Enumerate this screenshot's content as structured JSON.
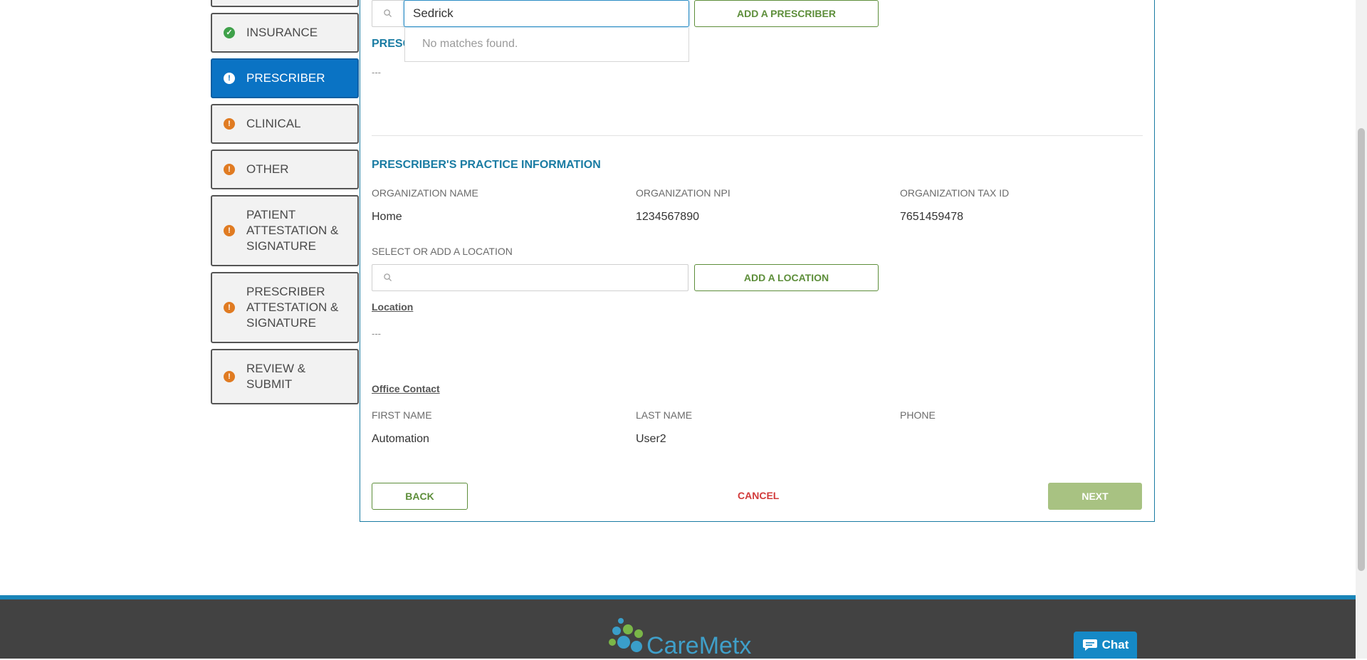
{
  "sidebar": {
    "items": [
      {
        "label": "INSURANCE",
        "status": "complete"
      },
      {
        "label": "PRESCRIBER",
        "status": "active"
      },
      {
        "label": "CLINICAL",
        "status": "incomplete"
      },
      {
        "label": "OTHER",
        "status": "incomplete"
      },
      {
        "label_lines": [
          "PATIENT",
          "ATTESTATION &",
          "SIGNATURE"
        ],
        "status": "incomplete"
      },
      {
        "label_lines": [
          "PRESCRIBER",
          "ATTESTATION &",
          "SIGNATURE"
        ],
        "status": "incomplete"
      },
      {
        "label_lines": [
          "REVIEW &",
          "SUBMIT"
        ],
        "status": "incomplete"
      }
    ],
    "status_icons": {
      "complete": "check-icon",
      "active": "alert-icon",
      "incomplete": "alert-icon"
    }
  },
  "prescriber_search": {
    "value": "Sedrick",
    "dropdown_text": "No matches found.",
    "add_button": "ADD A PRESCRIBER",
    "section_title_partial": "PRESC",
    "empty_value": "---"
  },
  "practice": {
    "title": "PRESCRIBER'S PRACTICE INFORMATION",
    "org_name_label": "ORGANIZATION NAME",
    "org_name_value": "Home",
    "org_npi_label": "ORGANIZATION NPI",
    "org_npi_value": "1234567890",
    "org_tax_label": "ORGANIZATION TAX ID",
    "org_tax_value": "7651459478",
    "location_label": "SELECT OR ADD A LOCATION",
    "add_location_button": "ADD A LOCATION",
    "location_heading": "Location",
    "location_value": "---",
    "office_contact_heading": "Office Contact",
    "first_name_label": "FIRST NAME",
    "first_name_value": "Automation",
    "last_name_label": "LAST NAME",
    "last_name_value": "User2",
    "phone_label": "PHONE"
  },
  "actions": {
    "back": "BACK",
    "cancel": "CANCEL",
    "next": "NEXT"
  },
  "footer": {
    "logo_text": "CareMetx",
    "chat_label": "Chat"
  },
  "colors": {
    "accent_blue": "#1a7ca3",
    "active_blue": "#0a73c4",
    "green": "#5d8e3a",
    "next_green": "#a8c282",
    "cancel_red": "#d23b3b",
    "warn_orange": "#e07b22",
    "ok_green": "#3fa14a",
    "footer_gray": "#424242"
  }
}
